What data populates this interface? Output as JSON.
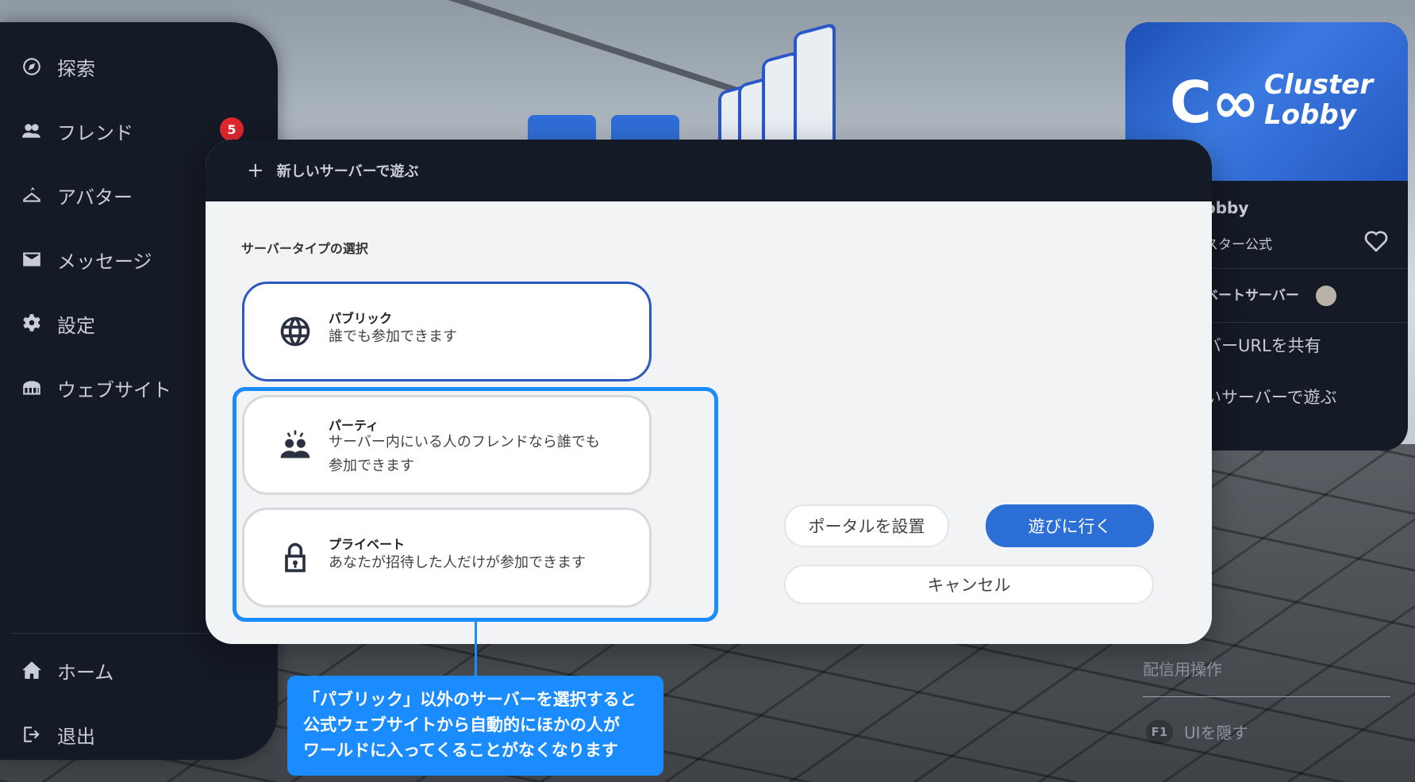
{
  "sidebar": {
    "items": [
      {
        "label": "探索",
        "icon": "compass-icon"
      },
      {
        "label": "フレンド",
        "icon": "friends-icon",
        "badge": "5"
      },
      {
        "label": "アバター",
        "icon": "hanger-icon"
      },
      {
        "label": "メッセージ",
        "icon": "mail-icon"
      },
      {
        "label": "設定",
        "icon": "gear-icon"
      },
      {
        "label": "ウェブサイト",
        "icon": "website-icon"
      }
    ],
    "bottom_items": [
      {
        "label": "ホーム",
        "icon": "home-icon"
      },
      {
        "label": "退出",
        "icon": "exit-icon"
      }
    ]
  },
  "world_card": {
    "thumbnail_logo": "Cluster Lobby",
    "logo_line1": "Cluster",
    "logo_line2": "Lobby",
    "title_partial": "obby",
    "owner_partial": "スター公式",
    "server_label_partial": "ベートサーバー",
    "share_partial": "バーURLを共有",
    "new_server_partial": "いサーバーで遊ぶ"
  },
  "right_lower": {
    "stream_ops": "配信用操作",
    "key": "F1",
    "hide_ui": "UIを隠す"
  },
  "modal": {
    "header_title": "新しいサーバーで遊ぶ",
    "section_title": "サーバータイプの選択",
    "options": [
      {
        "name": "パブリック",
        "description": "誰でも参加できます",
        "icon": "globe-icon",
        "selected": true
      },
      {
        "name": "パーティ",
        "description_line1": "サーバー内にいる人のフレンドなら誰でも",
        "description_line2": "参加できます",
        "icon": "party-icon"
      },
      {
        "name": "プライベート",
        "description": "あなたが招待した人だけが参加できます",
        "icon": "lock-icon"
      }
    ],
    "buttons": {
      "portal": "ポータルを設置",
      "play": "遊びに行く",
      "cancel": "キャンセル"
    }
  },
  "callout": {
    "line1": "「パブリック」以外のサーバーを選択すると",
    "line2": "公式ウェブサイトから自動的にほかの人が",
    "line3": "ワールドに入ってくることがなくなります"
  },
  "colors": {
    "dark_panel": "#141a26",
    "accent_blue": "#2b6fd6",
    "callout_blue": "#1a8cff",
    "badge_red": "#e0282e"
  }
}
